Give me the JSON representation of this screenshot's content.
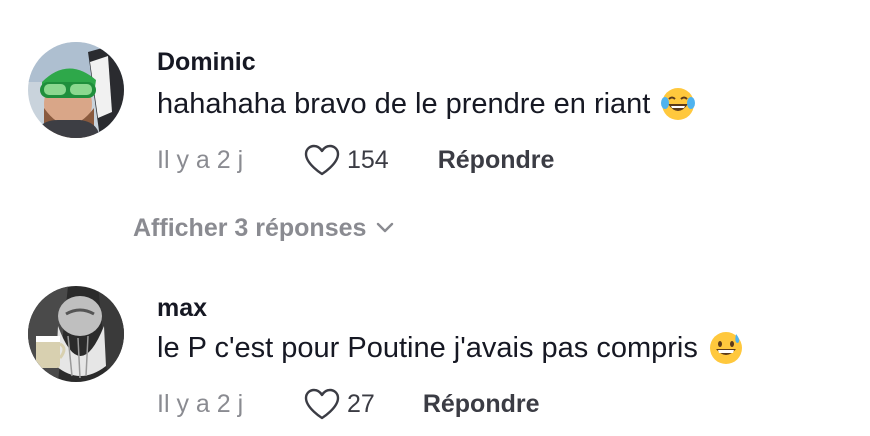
{
  "comments": [
    {
      "username": "Dominic",
      "text": "hahahaha bravo de le prendre en riant",
      "emoji": "face-with-tears-of-joy-emoji",
      "time": "Il y a 2 j",
      "likes": "154",
      "reply_label": "Répondre",
      "avatar": "man-with-green-helmet-avatar"
    },
    {
      "username": "max",
      "text": "le P c'est pour Poutine j'avais pas compris",
      "emoji": "grinning-face-with-sweat-emoji",
      "time": "Il y a 2 j",
      "likes": "27",
      "reply_label": "Répondre",
      "avatar": "bearded-man-with-beer-sketch-avatar"
    }
  ],
  "view_replies": {
    "label": "Afficher 3 réponses",
    "icon": "chevron-down-icon"
  },
  "colors": {
    "primary_text": "#161823",
    "secondary_text": "#8a8b91",
    "action_text": "#3b3c44"
  }
}
